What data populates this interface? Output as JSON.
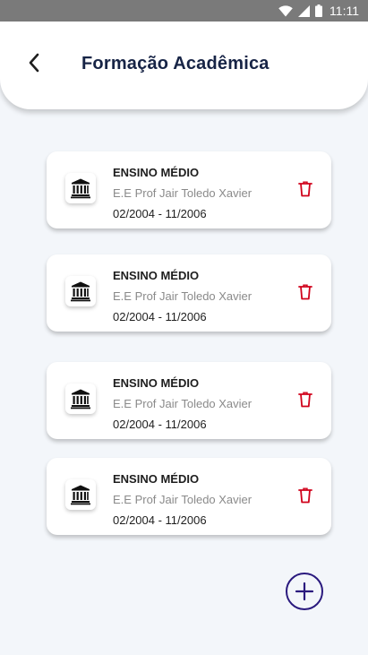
{
  "status_bar": {
    "time": "11:11",
    "icons": [
      "wifi-icon",
      "signal-icon",
      "battery-icon"
    ]
  },
  "header": {
    "title": "Formação Acadêmica",
    "back_icon": "chevron-left-icon"
  },
  "education": [
    {
      "title": "ENSINO MÉDIO",
      "school": "E.E Prof Jair Toledo Xavier",
      "period": "02/2004 - 11/2006"
    },
    {
      "title": "ENSINO MÉDIO",
      "school": "E.E Prof Jair Toledo Xavier",
      "period": "02/2004 - 11/2006"
    },
    {
      "title": "ENSINO MÉDIO",
      "school": "E.E Prof Jair Toledo Xavier",
      "period": "02/2004 - 11/2006"
    },
    {
      "title": "ENSINO MÉDIO",
      "school": "E.E Prof Jair Toledo Xavier",
      "period": "02/2004 - 11/2006"
    }
  ],
  "icons": {
    "institution": "institution-icon",
    "delete": "trash-icon",
    "add": "plus-icon"
  },
  "colors": {
    "title_text": "#172446",
    "delete": "#d0021b",
    "add_button": "#2a1a7e",
    "status_bar": "#7a7a7a",
    "background": "#f3f6fa"
  }
}
